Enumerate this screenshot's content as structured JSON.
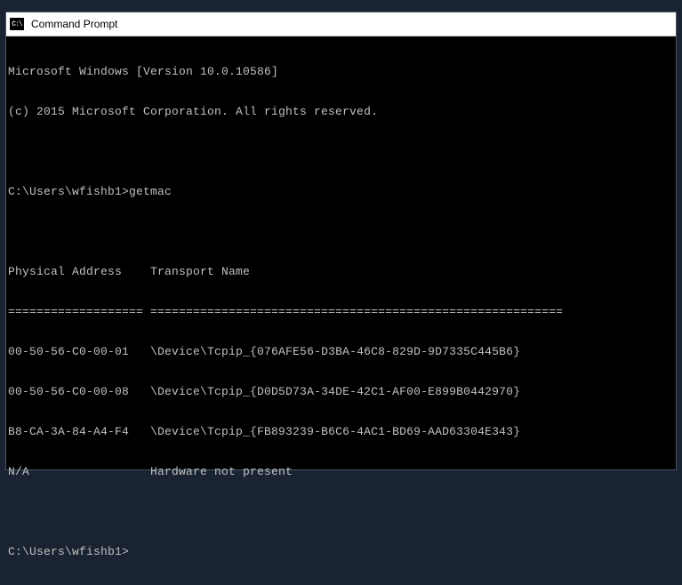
{
  "window": {
    "title": "Command Prompt",
    "icon_text": "C:\\"
  },
  "terminal": {
    "line1": "Microsoft Windows [Version 10.0.10586]",
    "line2": "(c) 2015 Microsoft Corporation. All rights reserved.",
    "blank1": "",
    "prompt1": "C:\\Users\\wfishb1>",
    "command1": "getmac",
    "blank2": "",
    "header": "Physical Address    Transport Name",
    "divider": "=================== ==========================================================",
    "row1_addr": "00-50-56-C0-00-01",
    "row1_transport": "   \\Device\\Tcpip_{076AFE56-D3BA-46C8-829D-9D7335C445B6}",
    "row2_addr": "00-50-56-C0-00-08",
    "row2_transport": "   \\Device\\Tcpip_{D0D5D73A-34DE-42C1-AF00-E899B0442970}",
    "row3_addr": "B8-CA-3A-84-A4-F4",
    "row3_transport": "   \\Device\\Tcpip_{FB893239-B6C6-4AC1-BD69-AAD63304E343}",
    "row4_addr": "N/A",
    "row4_transport": "                 Hardware not present",
    "blank3": "",
    "prompt2": "C:\\Users\\wfishb1>"
  }
}
